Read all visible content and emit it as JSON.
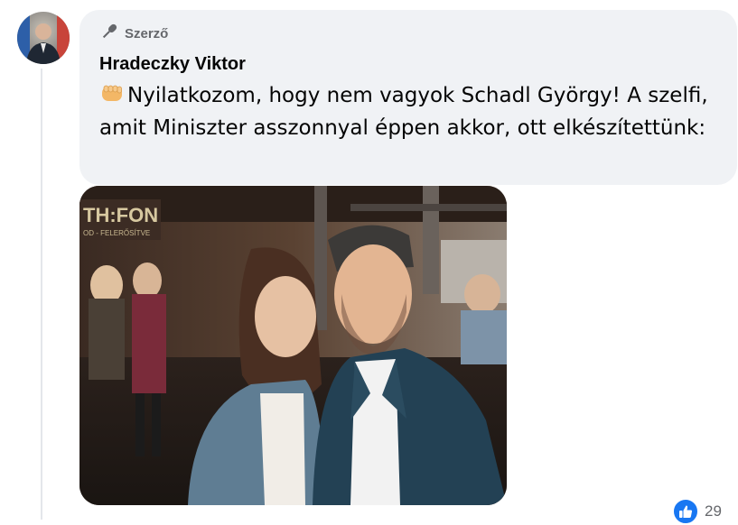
{
  "comment": {
    "author_badge": "Szerző",
    "author_name": "Hradeczky Viktor",
    "text": "Nyilatkozom, hogy nem vagyok Schadl György! A szelfi, amit Miniszter asszonnyal éppen akkor, ott elkészítettünk:",
    "emoji_icon": "fist-icon",
    "badge_icon": "microphone-icon"
  },
  "photo": {
    "background_sign": "TH:FON",
    "background_sign_sub": "OD - FELERŐSÍTVE"
  },
  "reactions": {
    "icon": "like-icon",
    "count": "29"
  },
  "colors": {
    "bubble": "#f0f2f5",
    "like": "#1877f2",
    "secondary_text": "#65676b"
  }
}
